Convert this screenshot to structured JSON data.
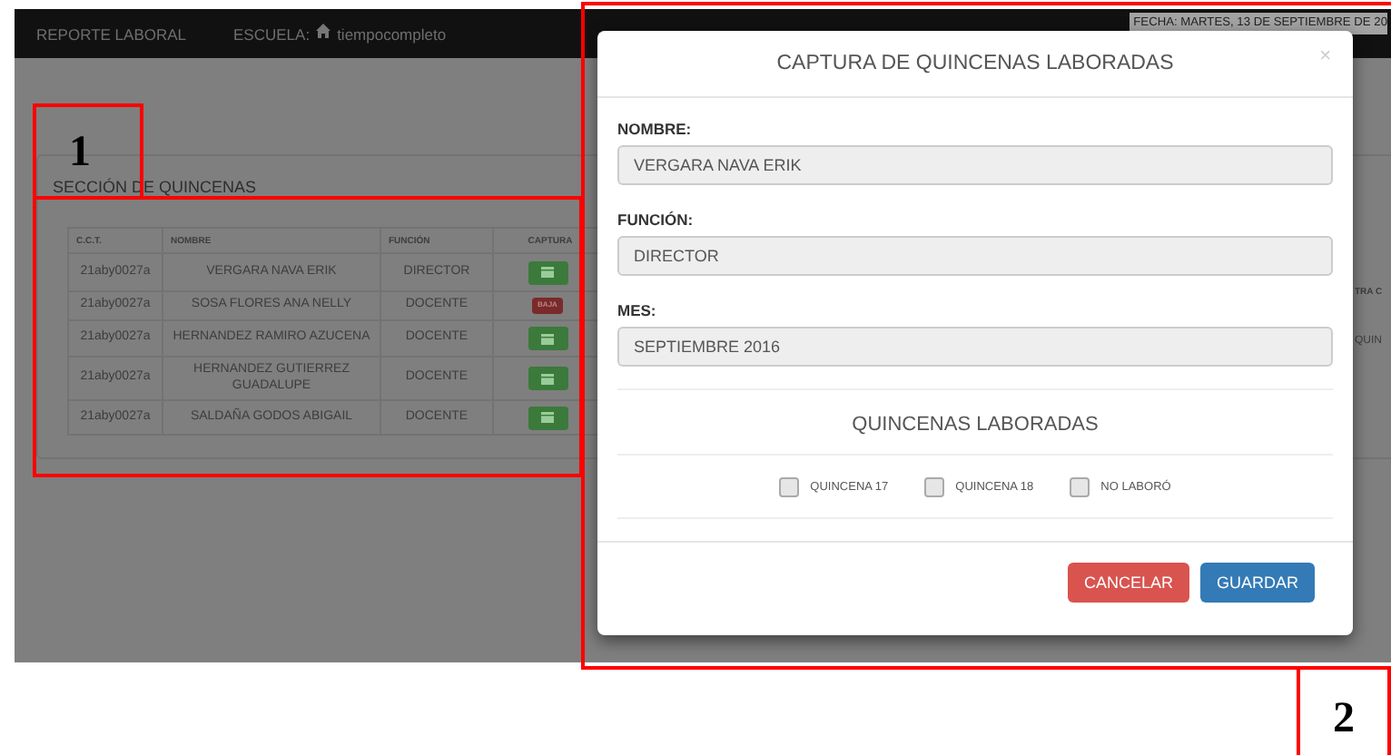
{
  "navbar": {
    "title": "REPORTE LABORAL",
    "school_label": "ESCUELA:",
    "school": "tiempocompleto",
    "date": "FECHA: MARTES, 13 DE SEPTIEMBRE DE 20"
  },
  "section": {
    "title": "SECCIÓN DE QUINCENAS",
    "table": {
      "columns": [
        "C.C.T.",
        "NOMBRE",
        "FUNCIÓN",
        "CAPTURA"
      ],
      "rows": [
        {
          "cct": "21aby0027a",
          "nombre": "VERGARA NAVA ERIK",
          "funcion": "DIRECTOR",
          "captura": {
            "kind": "button"
          }
        },
        {
          "cct": "21aby0027a",
          "nombre": "SOSA FLORES ANA NELLY",
          "funcion": "DOCENTE",
          "captura": {
            "kind": "badge",
            "label": "BAJA"
          }
        },
        {
          "cct": "21aby0027a",
          "nombre": "HERNANDEZ RAMIRO AZUCENA",
          "funcion": "DOCENTE",
          "captura": {
            "kind": "button"
          }
        },
        {
          "cct": "21aby0027a",
          "nombre": "HERNANDEZ GUTIERREZ GUADALUPE",
          "funcion": "DOCENTE",
          "captura": {
            "kind": "button"
          }
        },
        {
          "cct": "21aby0027a",
          "nombre": "SALDAÑA GODOS ABIGAIL",
          "funcion": "DOCENTE",
          "captura": {
            "kind": "button"
          }
        }
      ]
    },
    "right_fragment": {
      "column_5": "TRA C",
      "cell": "QUIN"
    }
  },
  "modal": {
    "title": "CAPTURA DE QUINCENAS LABORADAS",
    "close": "×",
    "fields": [
      {
        "label": "NOMBRE:",
        "value": "VERGARA NAVA ERIK"
      },
      {
        "label": "FUNCIÓN:",
        "value": "DIRECTOR"
      },
      {
        "label": "MES:",
        "value": "SEPTIEMBRE 2016"
      }
    ],
    "section_title": "QUINCENAS LABORADAS",
    "checkboxes": [
      {
        "label": "QUINCENA 17",
        "checked": false
      },
      {
        "label": "QUINCENA 18",
        "checked": false
      },
      {
        "label": "NO LABORÓ",
        "checked": false
      }
    ],
    "buttons": [
      {
        "label": "CANCELAR",
        "kind": "danger"
      },
      {
        "label": "GUARDAR",
        "kind": "primary"
      }
    ]
  },
  "annotations": [
    {
      "label": "1"
    },
    {
      "label": "2"
    }
  ]
}
